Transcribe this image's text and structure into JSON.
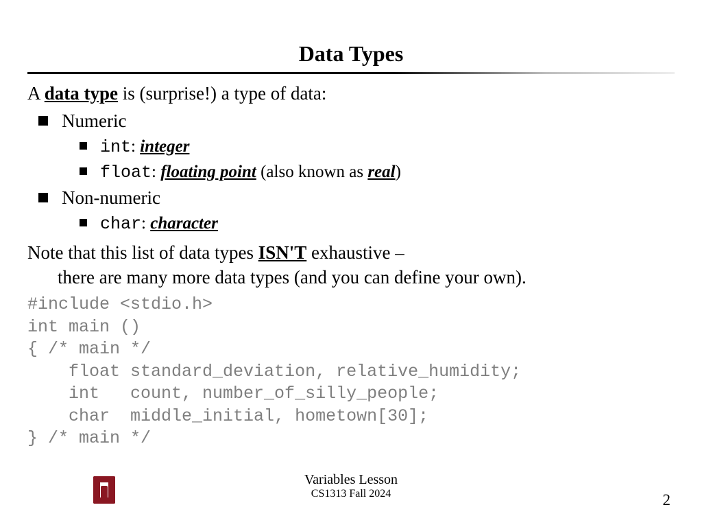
{
  "title": "Data Types",
  "intro": {
    "pre": "A ",
    "term": "data type",
    "post": " is (surprise!) a type of data:"
  },
  "numeric": {
    "label": "Numeric",
    "int_kw": "int",
    "int_colon": ":   ",
    "int_def": "integer",
    "float_kw": "float",
    "float_colon": ": ",
    "float_def": "floating point",
    "float_aka_pre": " (also known as ",
    "float_aka": "real",
    "float_aka_post": ")"
  },
  "nonnumeric": {
    "label": "Non-numeric",
    "char_kw": "char",
    "char_colon": ":  ",
    "char_def": "character"
  },
  "note": {
    "l1_pre": "Note that this list of data types ",
    "l1_em": "ISN'T",
    "l1_post": " exhaustive –",
    "l2": "there are many more data types (and you can define your own)."
  },
  "code": "#include <stdio.h>\nint main ()\n{ /* main */\n    float standard_deviation, relative_humidity;\n    int   count, number_of_silly_people;\n    char  middle_initial, hometown[30];\n} /* main */",
  "footer": {
    "lesson": "Variables Lesson",
    "course": "CS1313 Fall 2024",
    "page": "2"
  }
}
